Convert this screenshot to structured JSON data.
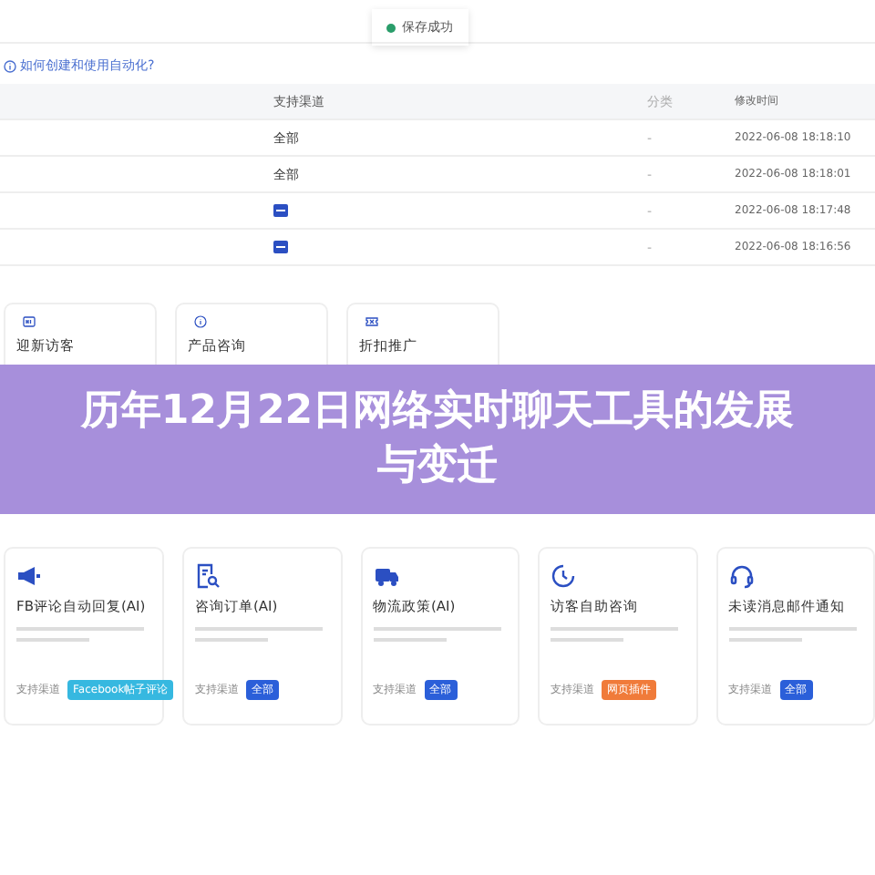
{
  "toast": {
    "text": "保存成功"
  },
  "help_link": "如何创建和使用自动化?",
  "table": {
    "columns": [
      "支持渠道",
      "分类",
      "修改时间"
    ],
    "rows": [
      {
        "kind": "text",
        "channel": "全部",
        "category": "-",
        "time": "2022-06-08 18:18:10"
      },
      {
        "kind": "text",
        "channel": "全部",
        "category": "-",
        "time": "2022-06-08 18:18:01"
      },
      {
        "kind": "icon",
        "category": "-",
        "time": "2022-06-08 18:17:48"
      },
      {
        "kind": "icon",
        "category": "-",
        "time": "2022-06-08 18:16:56"
      }
    ]
  },
  "top_cards": [
    {
      "title": "迎新访客"
    },
    {
      "title": "产品咨询"
    },
    {
      "title": "折扣推广"
    }
  ],
  "banner": {
    "title": "历年12月22日网络实时聊天工具的发展与变迁"
  },
  "cards": [
    {
      "title": "FB评论自动回复(AI)",
      "channel_label": "支持渠道",
      "tag": "Facebook帖子评论",
      "color": "#36b8e0"
    },
    {
      "title": "咨询订单(AI)",
      "channel_label": "支持渠道",
      "tag": "全部",
      "color": "#2b5fd9"
    },
    {
      "title": "物流政策(AI)",
      "channel_label": "支持渠道",
      "tag": "全部",
      "color": "#2b5fd9"
    },
    {
      "title": "访客自助咨询",
      "channel_label": "支持渠道",
      "tag": "网页插件",
      "color": "#f07b3a"
    },
    {
      "title": "未读消息邮件通知",
      "channel_label": "支持渠道",
      "tag": "全部",
      "color": "#2b5fd9"
    }
  ]
}
